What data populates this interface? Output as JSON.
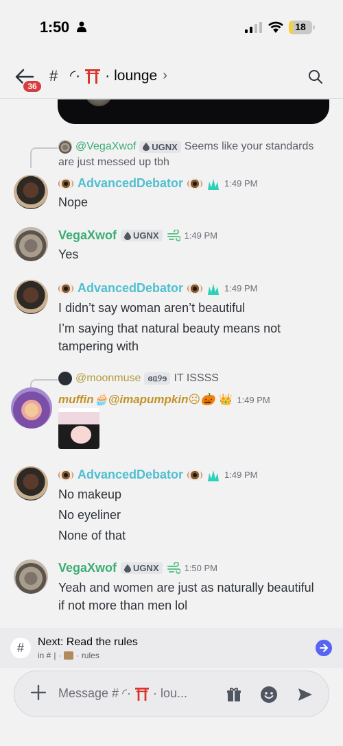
{
  "status_bar": {
    "time": "1:50",
    "battery_level": "18",
    "battery_fraction": 0.18
  },
  "header": {
    "unread_count": "36",
    "channel_prefix": "#",
    "channel_deco": "◜·",
    "channel_dot": "·",
    "channel_name": "lounge",
    "chevron": "›"
  },
  "messages": [
    {
      "reply": {
        "name": "@VegaXwof",
        "tag": "UGNX",
        "text": "Seems like your standards",
        "text2": "are just messed up tbh"
      },
      "author": "AdvancedDebator",
      "time": "1:49 PM",
      "lines": [
        "Nope"
      ]
    },
    {
      "author": "VegaXwof",
      "tag": "UGNX",
      "time": "1:49 PM",
      "lines": [
        "Yes"
      ]
    },
    {
      "author": "AdvancedDebator",
      "time": "1:49 PM",
      "lines": [
        "I didn’t say woman aren’t beautiful",
        "I’m saying that natural beauty means not",
        "tampering with"
      ]
    },
    {
      "reply": {
        "name": "@moonmuse",
        "tag": "ɞᥲ୨ɘ",
        "text": "IT ISSSS"
      },
      "author": "muffin🧁@imapumpkin☹🎃",
      "time": "1:49 PM"
    },
    {
      "author": "AdvancedDebator",
      "time": "1:49 PM",
      "lines": [
        "No makeup",
        "No eyeliner",
        "None of that"
      ]
    },
    {
      "author": "VegaXwof",
      "tag": "UGNX",
      "time": "1:50 PM",
      "lines": [
        "Yeah and women are just as naturally beautiful",
        "if not more than men lol"
      ]
    }
  ],
  "next_bar": {
    "title": "Next: Read the rules",
    "in_label": "in #",
    "sep": "|",
    "dot": "·",
    "channel": "· rules"
  },
  "composer": {
    "placeholder_prefix": "Message #",
    "placeholder_deco": "◜·",
    "placeholder_suffix": "· lou..."
  },
  "colors": {
    "accent": "#5865f2",
    "badge": "#d83c3e",
    "cyan_name": "#4fbfd0",
    "green_name": "#3bae74"
  }
}
